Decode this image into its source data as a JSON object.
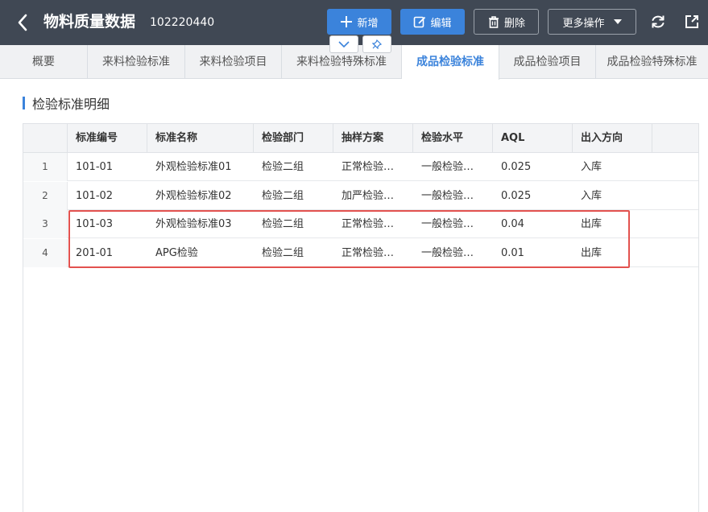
{
  "header": {
    "title": "物料质量数据",
    "code": "102220440",
    "buttons": {
      "add": "新增",
      "edit": "编辑",
      "delete": "删除",
      "more": "更多操作"
    },
    "icons": [
      "back-icon",
      "plus-icon",
      "edit-icon",
      "trash-icon",
      "caret-down-icon",
      "refresh-icon",
      "share-icon",
      "chevron-down-icon",
      "pin-icon"
    ]
  },
  "tabs": [
    {
      "label": "概要",
      "active": false
    },
    {
      "label": "来料检验标准",
      "active": false
    },
    {
      "label": "来料检验项目",
      "active": false
    },
    {
      "label": "来料检验特殊标准",
      "active": false
    },
    {
      "label": "成品检验标准",
      "active": true
    },
    {
      "label": "成品检验项目",
      "active": false
    },
    {
      "label": "成品检验特殊标准",
      "active": false
    }
  ],
  "section": {
    "title": "检验标准明细"
  },
  "table": {
    "columns": [
      "标准编号",
      "标准名称",
      "检验部门",
      "抽样方案",
      "检验水平",
      "AQL",
      "出入方向"
    ],
    "rows": [
      {
        "no": "1",
        "cells": [
          "101-01",
          "外观检验标准01",
          "检验二组",
          "正常检验…",
          "一般检验…",
          "0.025",
          "入库"
        ]
      },
      {
        "no": "2",
        "cells": [
          "101-02",
          "外观检验标准02",
          "检验二组",
          "加严检验…",
          "一般检验…",
          "0.025",
          "入库"
        ]
      },
      {
        "no": "3",
        "cells": [
          "101-03",
          "外观检验标准03",
          "检验二组",
          "正常检验…",
          "一般检验…",
          "0.04",
          "出库"
        ]
      },
      {
        "no": "4",
        "cells": [
          "201-01",
          "APG检验",
          "检验二组",
          "正常检验…",
          "一般检验…",
          "0.01",
          "出库"
        ]
      }
    ]
  },
  "colors": {
    "topbar": "#404854",
    "accent": "#3b83db",
    "highlight": "#e3524f"
  }
}
